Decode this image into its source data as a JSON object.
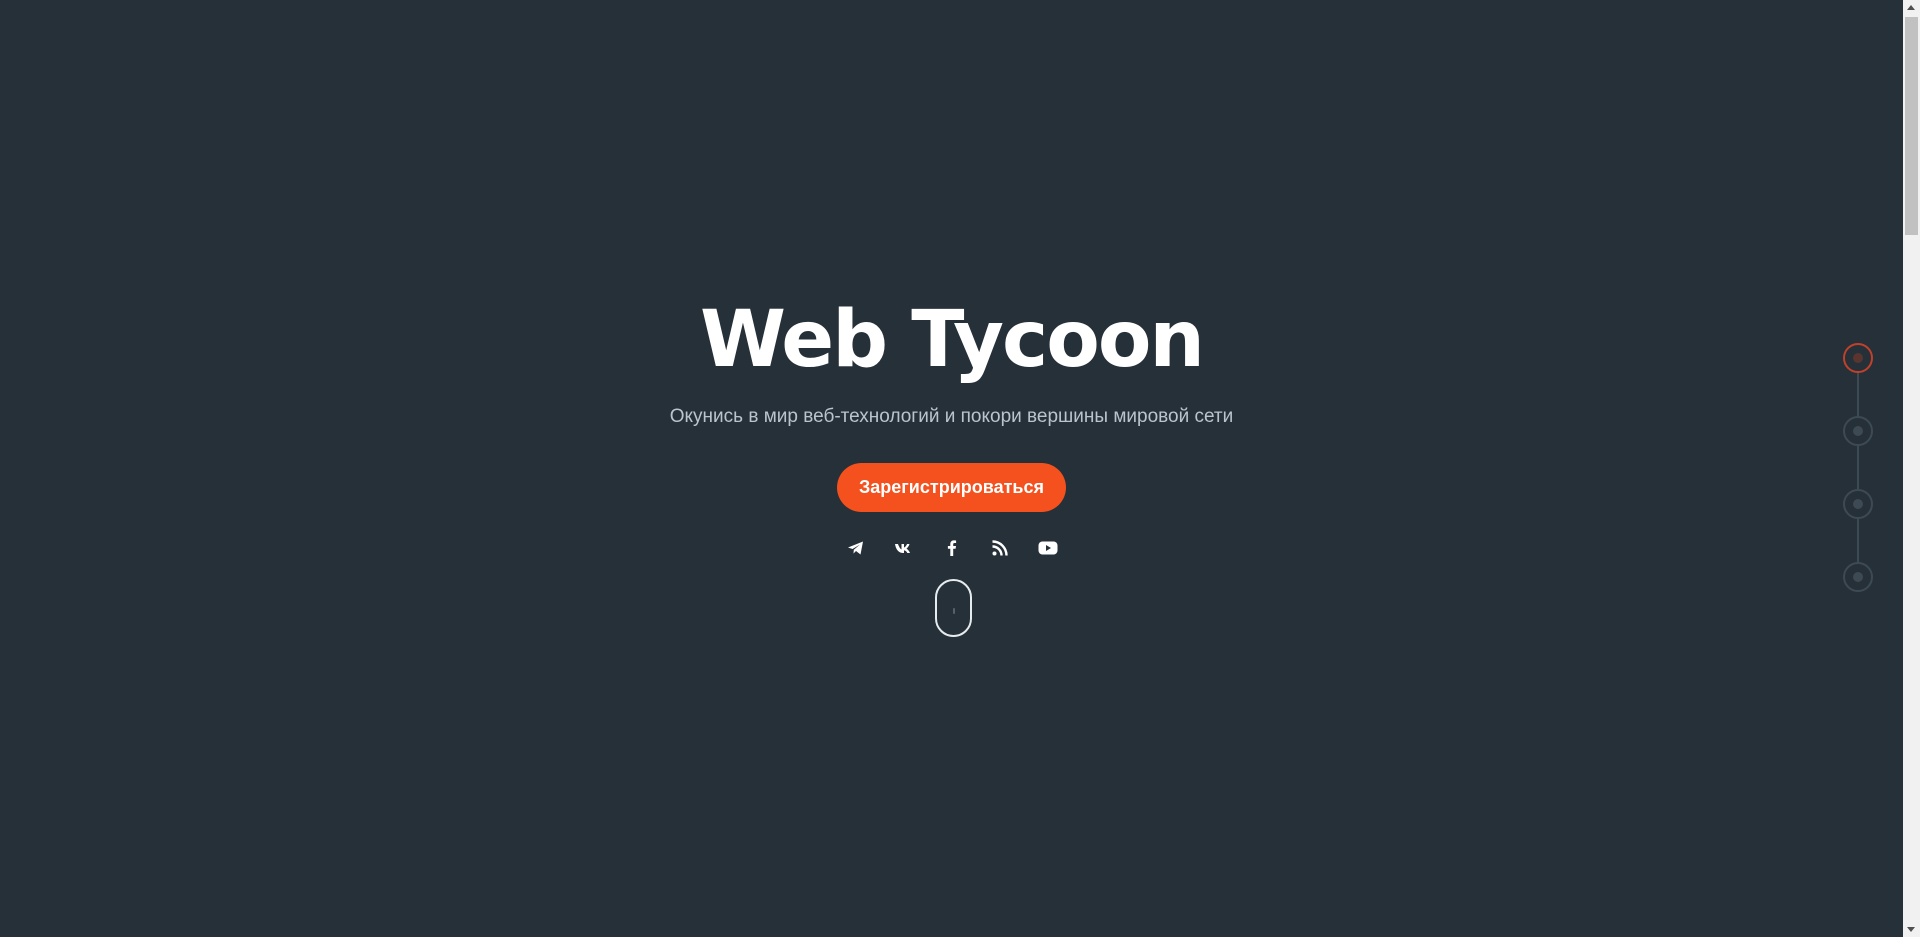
{
  "hero": {
    "title": "Web Tycoon",
    "subtitle": "Окунись в мир веб-технологий и покори вершины мировой сети",
    "cta_label": "Зарегистрироваться"
  },
  "social_links": [
    {
      "name": "telegram-icon"
    },
    {
      "name": "vk-icon"
    },
    {
      "name": "facebook-icon"
    },
    {
      "name": "rss-icon"
    },
    {
      "name": "youtube-icon"
    }
  ],
  "section_nav": {
    "count": 4,
    "active_index": 0
  },
  "colors": {
    "background": "#263038",
    "accent": "#f4511e",
    "subtitle": "#b9c4cc",
    "nav_inactive": "#3d4a54",
    "nav_active": "#c0412b"
  }
}
